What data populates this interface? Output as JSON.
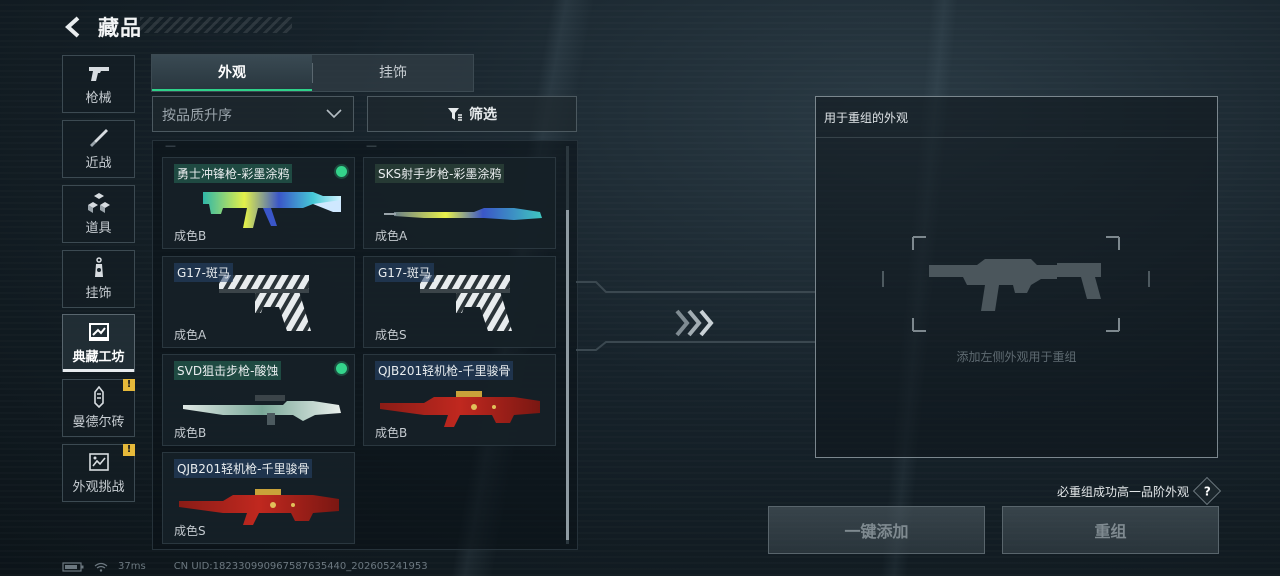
{
  "header": {
    "title": "藏品"
  },
  "sidebar": {
    "items": [
      {
        "label": "枪械",
        "icon": "pistol-icon",
        "active": false,
        "alert": false
      },
      {
        "label": "近战",
        "icon": "knife-icon",
        "active": false,
        "alert": false
      },
      {
        "label": "道具",
        "icon": "cubes-icon",
        "active": false,
        "alert": false
      },
      {
        "label": "挂饰",
        "icon": "charm-icon",
        "active": false,
        "alert": false
      },
      {
        "label": "典藏工坊",
        "icon": "workshop-icon",
        "active": true,
        "alert": false
      },
      {
        "label": "曼德尔砖",
        "icon": "mandel-brick-icon",
        "active": false,
        "alert": true
      },
      {
        "label": "外观挑战",
        "icon": "challenge-icon",
        "active": false,
        "alert": true
      }
    ],
    "alert_mark": "!"
  },
  "tabs": [
    {
      "label": "外观",
      "active": true
    },
    {
      "label": "挂饰",
      "active": false
    }
  ],
  "sort": {
    "value": "按品质升序"
  },
  "filter": {
    "label": "筛选"
  },
  "list": {
    "items": [
      {
        "name": "勇士冲锋枪-彩墨涂鸦",
        "grade": "成色B",
        "equipped": true,
        "skin": "graffiti"
      },
      {
        "name": "SKS射手步枪-彩墨涂鸦",
        "grade": "成色A",
        "equipped": false,
        "skin": "graffiti"
      },
      {
        "name": "G17-斑马",
        "grade": "成色A",
        "equipped": false,
        "skin": "zebra"
      },
      {
        "name": "G17-斑马",
        "grade": "成色S",
        "equipped": false,
        "skin": "zebra"
      },
      {
        "name": "SVD狙击步枪-酸蚀",
        "grade": "成色B",
        "equipped": true,
        "skin": "acid"
      },
      {
        "name": "QJB201轻机枪-千里骏骨",
        "grade": "成色B",
        "equipped": false,
        "skin": "red-gold"
      },
      {
        "name": "QJB201轻机枪-千里骏骨",
        "grade": "成色S",
        "equipped": false,
        "skin": "red-gold"
      }
    ]
  },
  "recombine": {
    "title": "用于重组的外观",
    "hint": "添加左侧外观用于重组",
    "info": "必重组成功高一品阶外观",
    "help": "?",
    "quick_add": "一键添加",
    "confirm": "重组"
  },
  "footer": {
    "ping": "37ms",
    "uid": "CN UID:182330990967587635440_202605241953"
  },
  "colors": {
    "accent": "#2fd28a",
    "alert": "#e6b93a"
  }
}
